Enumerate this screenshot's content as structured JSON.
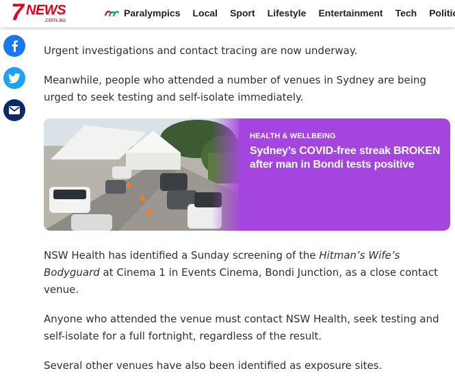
{
  "header": {
    "logo": {
      "seven": "7",
      "news": "NEWS",
      "domain": ".com.au"
    },
    "nav": [
      {
        "label": "Paralympics",
        "icon": "paralympics-agitos-icon"
      },
      {
        "label": "Local"
      },
      {
        "label": "Sport"
      },
      {
        "label": "Lifestyle"
      },
      {
        "label": "Entertainment"
      },
      {
        "label": "Tech"
      },
      {
        "label": "Politics"
      }
    ]
  },
  "social": [
    {
      "icon": "facebook-icon",
      "color": "#1877f2"
    },
    {
      "icon": "twitter-icon",
      "color": "#1da1f2"
    },
    {
      "icon": "email-icon",
      "color": "#0c2a6b"
    }
  ],
  "article": {
    "p1": "Urgent investigations and contact tracing are now underway.",
    "p2": "Meanwhile, people who attended a number of venues in Sydney are being urged to seek testing and self-isolate immediately.",
    "p3": {
      "before": "NSW Health has identified a Sunday screening of the ",
      "italic": "Hitman’s Wife’s Bodyguard",
      "after": " at Cinema 1 in Events Cinema, Bondi Junction, as a close contact venue."
    },
    "p4": "Anyone who attended the venue must contact NSW Health, seek testing and self-isolate for a full fortnight, regardless of the result.",
    "p5": "Several other venues have also been identified as exposure sites."
  },
  "related_card": {
    "category": "HEALTH & WELLBEING",
    "title": "Sydney’s COVID-free streak BROKEN after man in Bondi tests positive",
    "background_color": "#a545df",
    "image": "covid-testing-drive-through-cars"
  },
  "colors": {
    "brand_red": "#e4001b",
    "card_purple": "#a545df"
  }
}
